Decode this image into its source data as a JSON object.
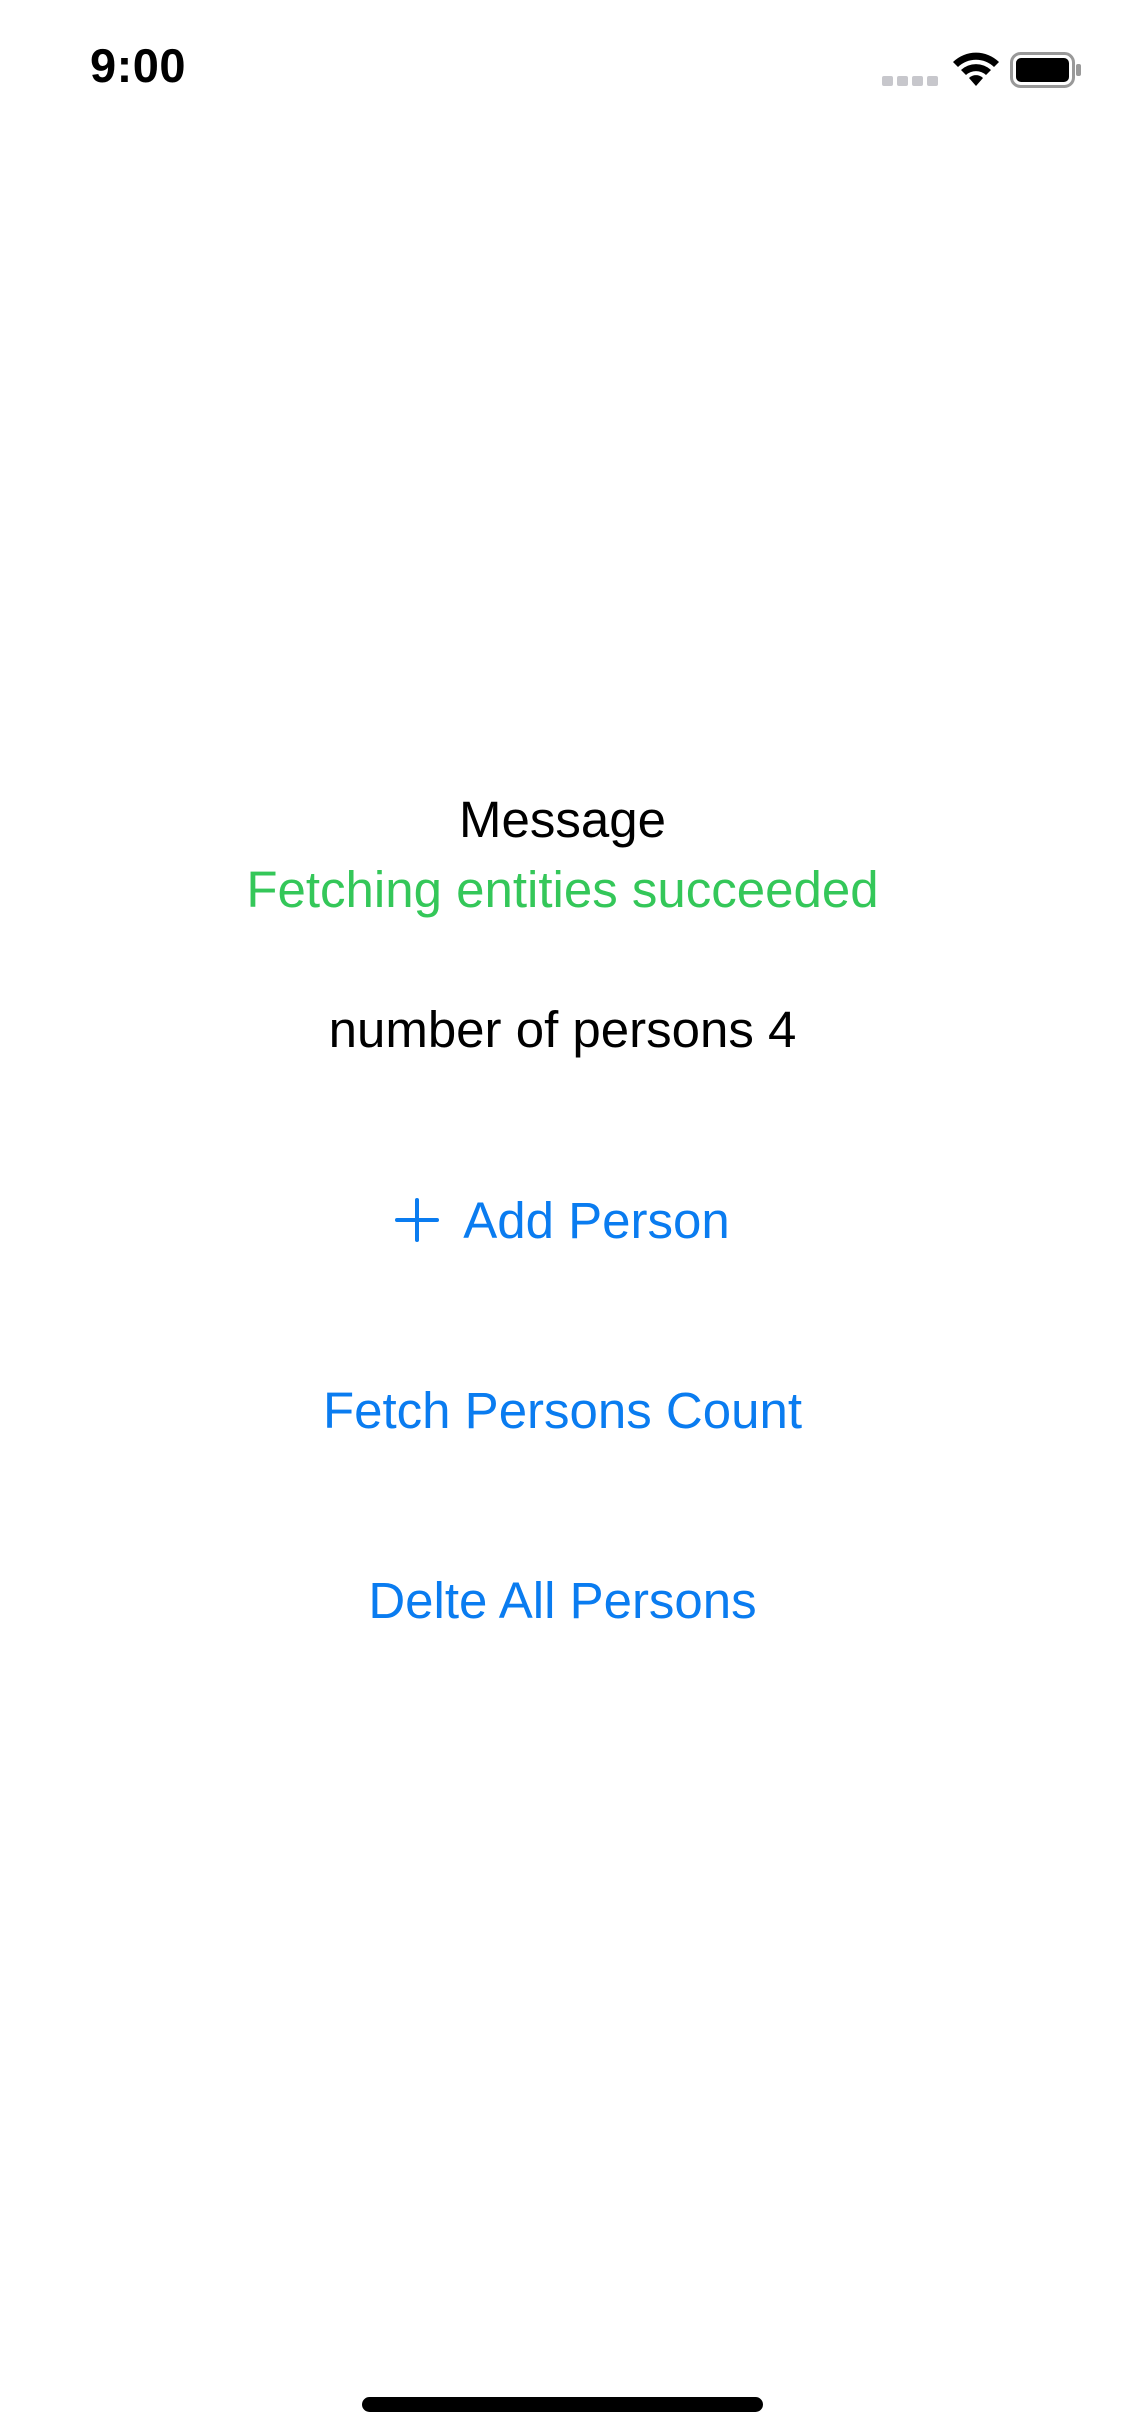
{
  "status_bar": {
    "time": "9:00",
    "icons": [
      "signal-icon",
      "wifi-icon",
      "battery-icon"
    ]
  },
  "message": {
    "title": "Message",
    "status": "Fetching entities succeeded",
    "status_color": "#34c759"
  },
  "count": {
    "text": "number of persons 4"
  },
  "actions": {
    "add_person_label": "Add Person",
    "add_person_icon": "plus-icon",
    "fetch_count_label": "Fetch Persons Count",
    "delete_all_label": "Delte All Persons",
    "accent_color": "#0a7cf0"
  }
}
